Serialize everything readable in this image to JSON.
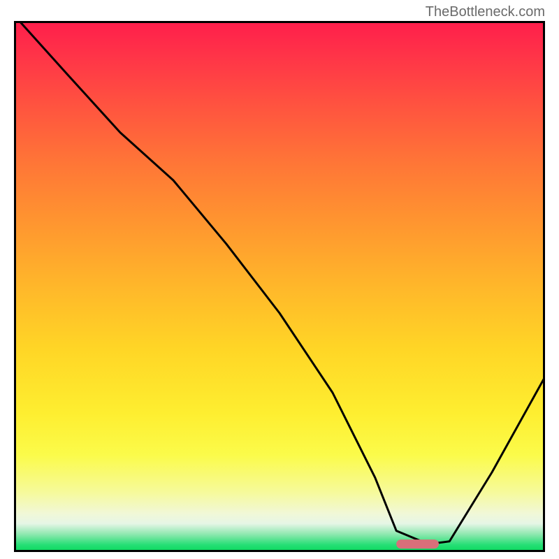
{
  "watermark": "TheBottleneck.com",
  "chart_data": {
    "type": "line",
    "title": "",
    "xlabel": "",
    "ylabel": "",
    "xlim": [
      0,
      100
    ],
    "ylim": [
      0,
      100
    ],
    "series": [
      {
        "name": "bottleneck-curve",
        "x": [
          1,
          10,
          20,
          30,
          40,
          50,
          60,
          68,
          72,
          78,
          82,
          90,
          100
        ],
        "y": [
          100,
          90,
          79,
          70,
          58,
          45,
          30,
          14,
          4,
          1.5,
          2,
          15,
          33
        ]
      }
    ],
    "markers": [
      {
        "name": "optimal-marker",
        "shape": "rounded-bar",
        "x_start": 72,
        "x_end": 80,
        "y": 1.5,
        "color": "#d96f7a"
      }
    ],
    "background": {
      "type": "vertical-gradient",
      "top_color": "#ff1f4b",
      "mid_color": "#ffd626",
      "bottom_color": "#10da63"
    },
    "grid": false,
    "legend": false
  }
}
